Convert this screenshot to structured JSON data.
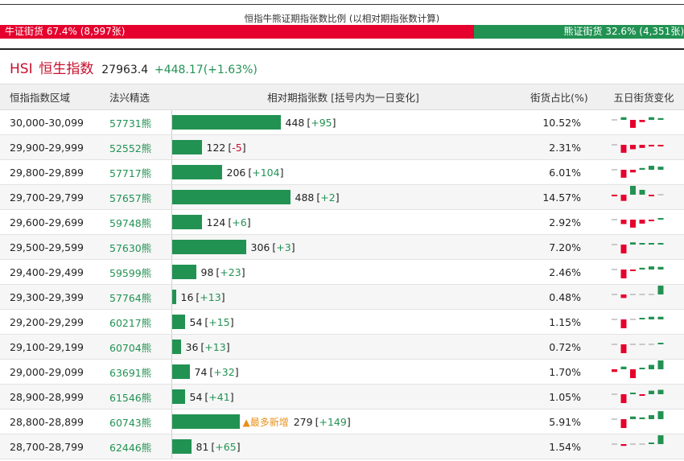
{
  "ratio": {
    "title": "恒指牛熊证期指张数比例 (以相对期指张数计算)",
    "bull_label": "牛证街货 67.4% (8,997张)",
    "bear_label": "熊证街货 32.6% (4,351张)",
    "bull_pct": 67.4
  },
  "index": {
    "code": "HSI",
    "name": "恒生指数",
    "value": "27963.4",
    "change": "+448.17(+1.63%)"
  },
  "columns": {
    "range": "恒指指数区域",
    "pick": "法兴精选",
    "bar": "相对期指张数 [括号内为一日变化]",
    "pct": "街货占比(%)",
    "hist": "五日街货变化"
  },
  "bar_scale_max": 488,
  "rows": [
    {
      "range": "30,000-30,099",
      "pick": "57731熊",
      "value": 448,
      "value_text": "448",
      "change_text": "+95",
      "pct": "10.52%",
      "hist": [
        0,
        0.3,
        -0.9,
        -0.25,
        0.3,
        0.2
      ]
    },
    {
      "range": "29,900-29,999",
      "pick": "52552熊",
      "value": 122,
      "value_text": "122",
      "change_text": "-5",
      "pct": "2.31%",
      "hist": [
        0,
        -0.9,
        -0.5,
        -0.35,
        -0.15,
        -0.1
      ]
    },
    {
      "range": "29,800-29,899",
      "pick": "57717熊",
      "value": 206,
      "value_text": "206",
      "change_text": "+104",
      "pct": "6.01%",
      "hist": [
        0,
        -0.9,
        -0.3,
        0.2,
        0.45,
        0.35
      ]
    },
    {
      "range": "29,700-29,799",
      "pick": "57657熊",
      "value": 488,
      "value_text": "488",
      "change_text": "+2",
      "pct": "14.57%",
      "hist": [
        -0.1,
        -0.7,
        1.0,
        0.55,
        -0.1,
        0
      ]
    },
    {
      "range": "29,600-29,699",
      "pick": "59748熊",
      "value": 124,
      "value_text": "124",
      "change_text": "+6",
      "pct": "2.92%",
      "hist": [
        0,
        -0.5,
        -0.9,
        -0.45,
        -0.1,
        0.1
      ]
    },
    {
      "range": "29,500-29,599",
      "pick": "57630熊",
      "value": 306,
      "value_text": "306",
      "change_text": "+3",
      "pct": "7.20%",
      "hist": [
        0,
        -1.0,
        0.25,
        0.1,
        0.1,
        0.05
      ]
    },
    {
      "range": "29,400-29,499",
      "pick": "59599熊",
      "value": 98,
      "value_text": "98",
      "change_text": "+23",
      "pct": "2.46%",
      "hist": [
        0,
        -1.0,
        -0.15,
        0.2,
        0.35,
        0.3
      ]
    },
    {
      "range": "29,300-29,399",
      "pick": "57764熊",
      "value": 16,
      "value_text": "16",
      "change_text": "+13",
      "pct": "0.48%",
      "hist": [
        0,
        -0.4,
        0,
        0,
        0,
        1.0
      ]
    },
    {
      "range": "29,200-29,299",
      "pick": "60217熊",
      "value": 54,
      "value_text": "54",
      "change_text": "+15",
      "pct": "1.15%",
      "hist": [
        0,
        -1.0,
        0,
        0.1,
        0.3,
        0.3
      ]
    },
    {
      "range": "29,100-29,199",
      "pick": "60704熊",
      "value": 36,
      "value_text": "36",
      "change_text": "+13",
      "pct": "0.72%",
      "hist": [
        0,
        -1.0,
        0,
        0,
        0,
        0.1
      ]
    },
    {
      "range": "29,000-29,099",
      "pick": "63691熊",
      "value": 74,
      "value_text": "74",
      "change_text": "+32",
      "pct": "1.70%",
      "hist": [
        -0.3,
        0.3,
        -1.0,
        0.1,
        0.5,
        1.0
      ]
    },
    {
      "range": "28,900-28,999",
      "pick": "61546熊",
      "value": 54,
      "value_text": "54",
      "change_text": "+41",
      "pct": "1.05%",
      "hist": [
        0,
        -1.0,
        0.15,
        -0.1,
        0.4,
        0.5
      ]
    },
    {
      "range": "28,800-28,899",
      "pick": "60743熊",
      "value": 279,
      "value_text": "279",
      "change_text": "+149",
      "pct": "5.91%",
      "hot_label": "▲最多新增",
      "hist": [
        0,
        -1.0,
        0.3,
        0.2,
        0.45,
        0.9
      ]
    },
    {
      "range": "28,700-28,799",
      "pick": "62446熊",
      "value": 81,
      "value_text": "81",
      "change_text": "+65",
      "pct": "1.54%",
      "hist": [
        0,
        -0.2,
        0,
        0,
        0.1,
        1.0
      ]
    }
  ],
  "colors": {
    "red": "#e5002d",
    "green": "#229253",
    "orange": "#e8911a"
  }
}
